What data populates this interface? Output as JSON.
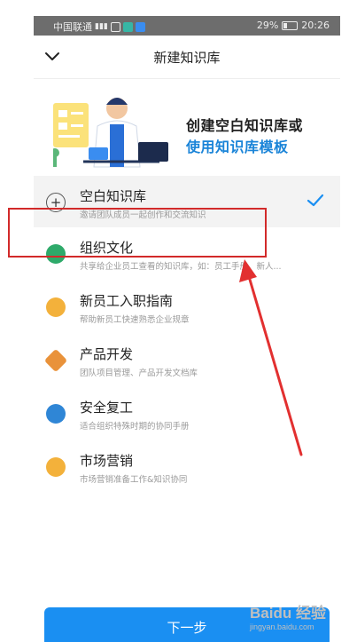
{
  "status_bar": {
    "carrier": "中国联通",
    "battery": "29%",
    "time": "20:26"
  },
  "header": {
    "title": "新建知识库"
  },
  "banner": {
    "line1": "创建空白知识库或",
    "line2": "使用知识库模板"
  },
  "items": [
    {
      "name": "空白知识库",
      "desc": "邀请团队成员一起创作和交流知识",
      "icon": "plus-icon",
      "color": "#555555"
    },
    {
      "name": "组织文化",
      "desc": "共享给企业员工查看的知识库，如：员工手册、新人...",
      "icon": "culture-icon",
      "color": "#2eaa6a"
    },
    {
      "name": "新员工入职指南",
      "desc": "帮助新员工快速熟悉企业规章",
      "icon": "onboarding-icon",
      "color": "#f3b13b"
    },
    {
      "name": "产品开发",
      "desc": "团队项目管理、产品开发文档库",
      "icon": "product-icon",
      "color": "#e9923a"
    },
    {
      "name": "安全复工",
      "desc": "适合组织特殊时期的协同手册",
      "icon": "shield-icon",
      "color": "#2f86d6"
    },
    {
      "name": "市场营销",
      "desc": "市场营销准备工作&知识协同",
      "icon": "marketing-icon",
      "color": "#f3b13b"
    }
  ],
  "button": {
    "label": "下一步"
  },
  "watermark": {
    "brand": "Baidu 经验",
    "url": "jingyan.baidu.com"
  },
  "colors": {
    "accent": "#1a8ff2",
    "annotation": "#d22a2a"
  }
}
